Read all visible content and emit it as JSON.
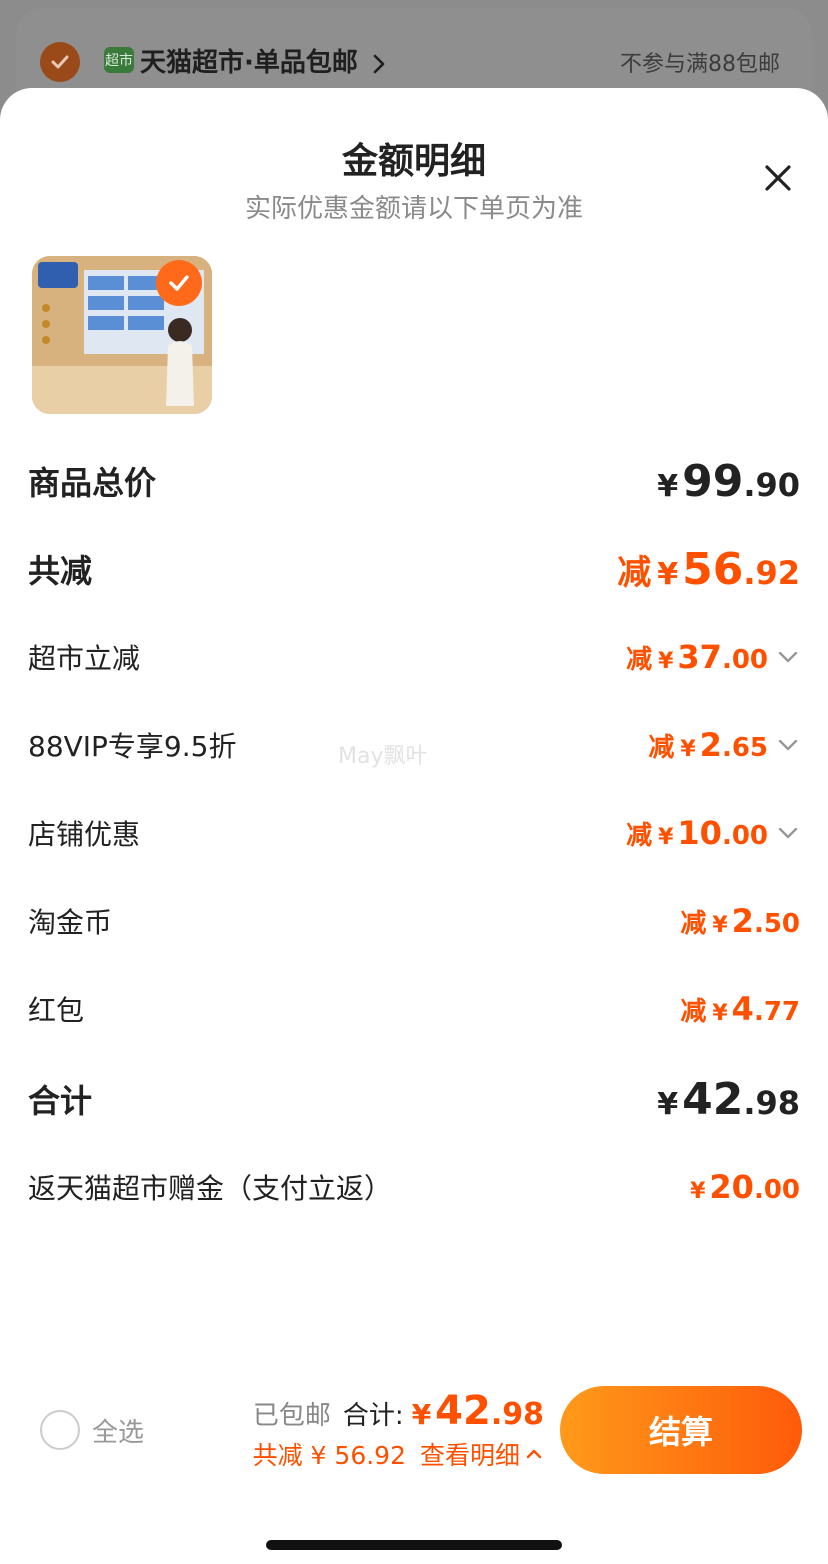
{
  "background": {
    "market_badge": "超市",
    "store_label": "天猫超市·单品包邮",
    "note": "不参与满88包邮"
  },
  "sheet": {
    "title": "金额明细",
    "subtitle": "实际优惠金额请以下单页为准",
    "watermark": "May飘叶"
  },
  "rows": {
    "total_price": {
      "label": "商品总价",
      "yen": "¥",
      "int": "99",
      "dec": ".90"
    },
    "total_discount": {
      "label": "共减",
      "prefix": "减",
      "yen": "¥",
      "int": "56",
      "dec": ".92"
    },
    "market_discount": {
      "label": "超市立减",
      "prefix": "减",
      "yen": "¥",
      "int": "37",
      "dec": ".00"
    },
    "vip_discount": {
      "label": "88VIP专享9.5折",
      "prefix": "减",
      "yen": "¥",
      "int": "2",
      "dec": ".65"
    },
    "store_discount": {
      "label": "店铺优惠",
      "prefix": "减",
      "yen": "¥",
      "int": "10",
      "dec": ".00"
    },
    "coins": {
      "label": "淘金币",
      "prefix": "减",
      "yen": "¥",
      "int": "2",
      "dec": ".50"
    },
    "red_packet": {
      "label": "红包",
      "prefix": "减",
      "yen": "¥",
      "int": "4",
      "dec": ".77"
    },
    "subtotal": {
      "label": "合计",
      "yen": "¥",
      "int": "42",
      "dec": ".98"
    },
    "cashback": {
      "label": "返天猫超市赠金（支付立返）",
      "yen": "¥",
      "int": "20",
      "dec": ".00"
    }
  },
  "bottom_bar": {
    "select_all": "全选",
    "free_shipping": "已包邮",
    "total_label": "合计:",
    "total_yen": "¥",
    "total_int": "42",
    "total_dec": ".98",
    "discount_text": "共减 ¥ 56.92",
    "detail_link": "查看明细",
    "checkout": "结算"
  },
  "colors": {
    "accent": "#ff5000",
    "checkout_gradient_start": "#ff9a1a",
    "checkout_gradient_end": "#ff5a0a",
    "text_primary": "#222222",
    "text_secondary": "#8a8a8a"
  },
  "icons": [
    "check-icon",
    "chevron-right-icon",
    "close-icon",
    "chevron-down-icon",
    "chevron-up-icon"
  ]
}
